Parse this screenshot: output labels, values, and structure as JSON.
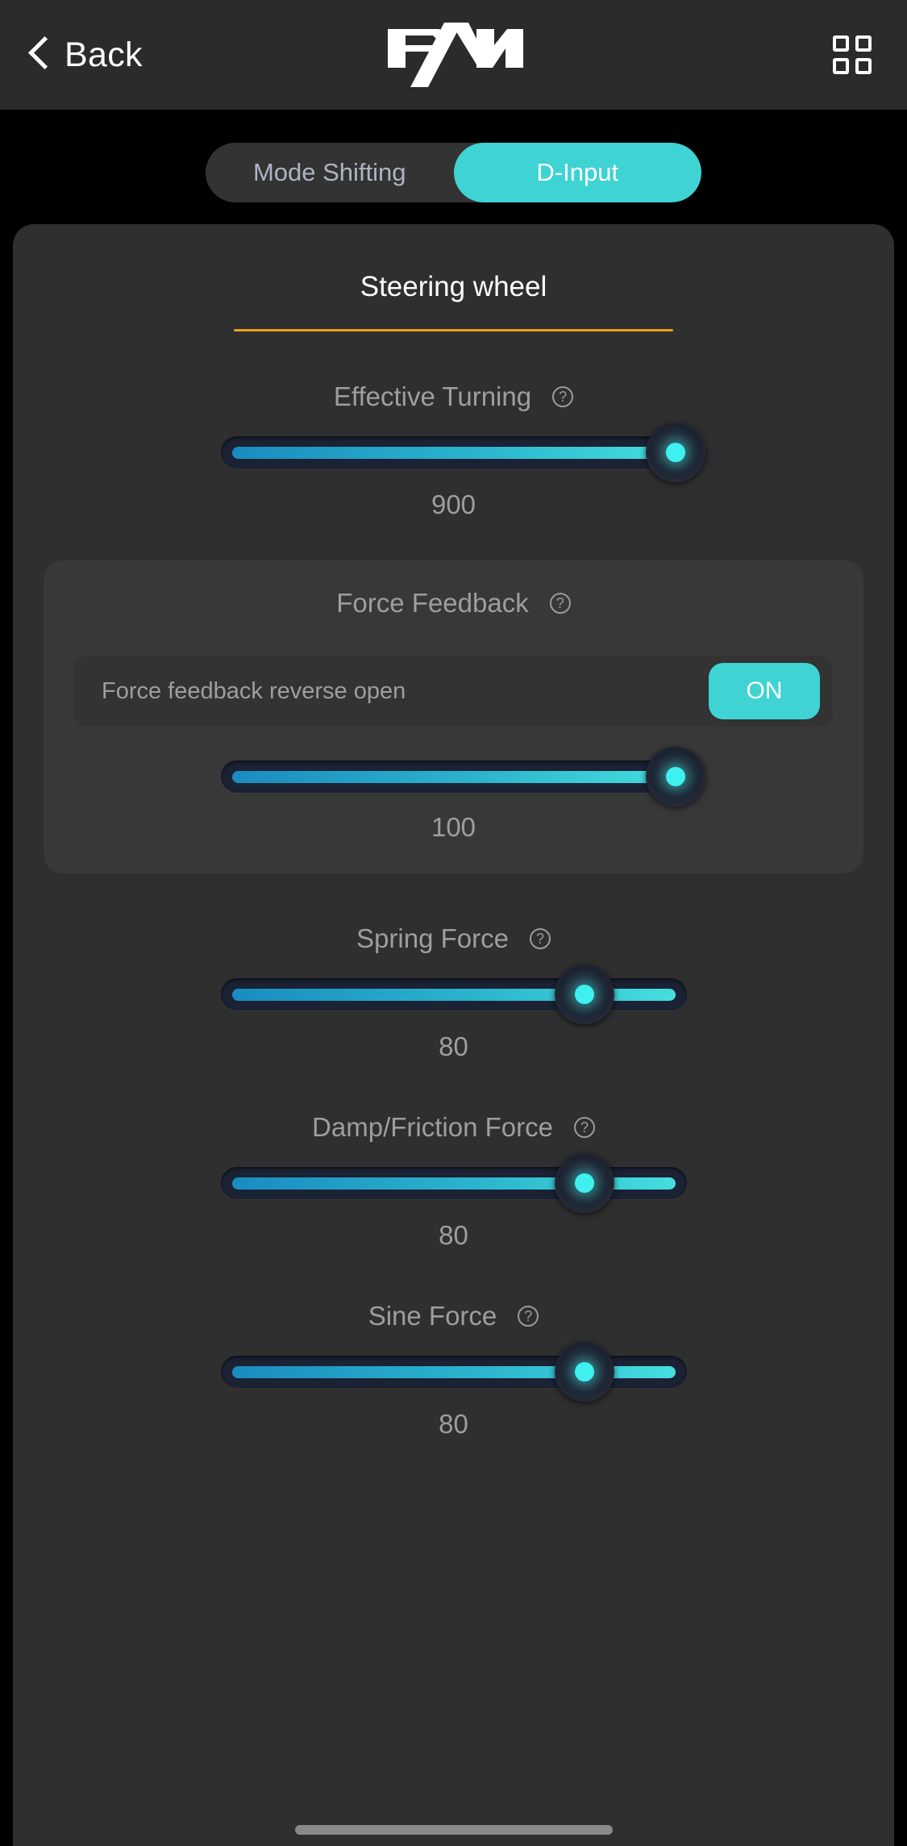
{
  "header": {
    "back_label": "Back",
    "back_icon": "chevron-left-icon",
    "logo_text": "PXN",
    "menu_icon": "grid-2x2-icon"
  },
  "mode_tabs": {
    "items": [
      {
        "label": "Mode Shifting",
        "active": false
      },
      {
        "label": "D-Input",
        "active": true
      }
    ]
  },
  "panel": {
    "title": "Steering wheel",
    "underline_color": "#efa01f"
  },
  "controls": {
    "effective_turning": {
      "label": "Effective Turning",
      "help_icon": "question-mark-circle-icon",
      "value": "900",
      "fill_percent": 100,
      "knob_percent": 100
    },
    "force_feedback": {
      "label": "Force Feedback",
      "help_icon": "question-mark-circle-icon",
      "toggle_label": "Force feedback reverse open",
      "toggle_state": "ON",
      "value": "100",
      "fill_percent": 100,
      "knob_percent": 100
    },
    "spring_force": {
      "label": "Spring Force",
      "help_icon": "question-mark-circle-icon",
      "value": "80",
      "fill_percent": 100,
      "knob_percent": 78
    },
    "damp_friction_force": {
      "label": "Damp/Friction Force",
      "help_icon": "question-mark-circle-icon",
      "value": "80",
      "fill_percent": 100,
      "knob_percent": 78
    },
    "sine_force": {
      "label": "Sine Force",
      "help_icon": "question-mark-circle-icon",
      "value": "80",
      "fill_percent": 100,
      "knob_percent": 78
    }
  },
  "colors": {
    "accent_cyan": "#3fd3d3",
    "accent_orange": "#efa01f",
    "slider_track": "#1b2234",
    "panel_bg": "#2f2f2f",
    "page_bg": "#000000"
  },
  "help_glyph": "?"
}
